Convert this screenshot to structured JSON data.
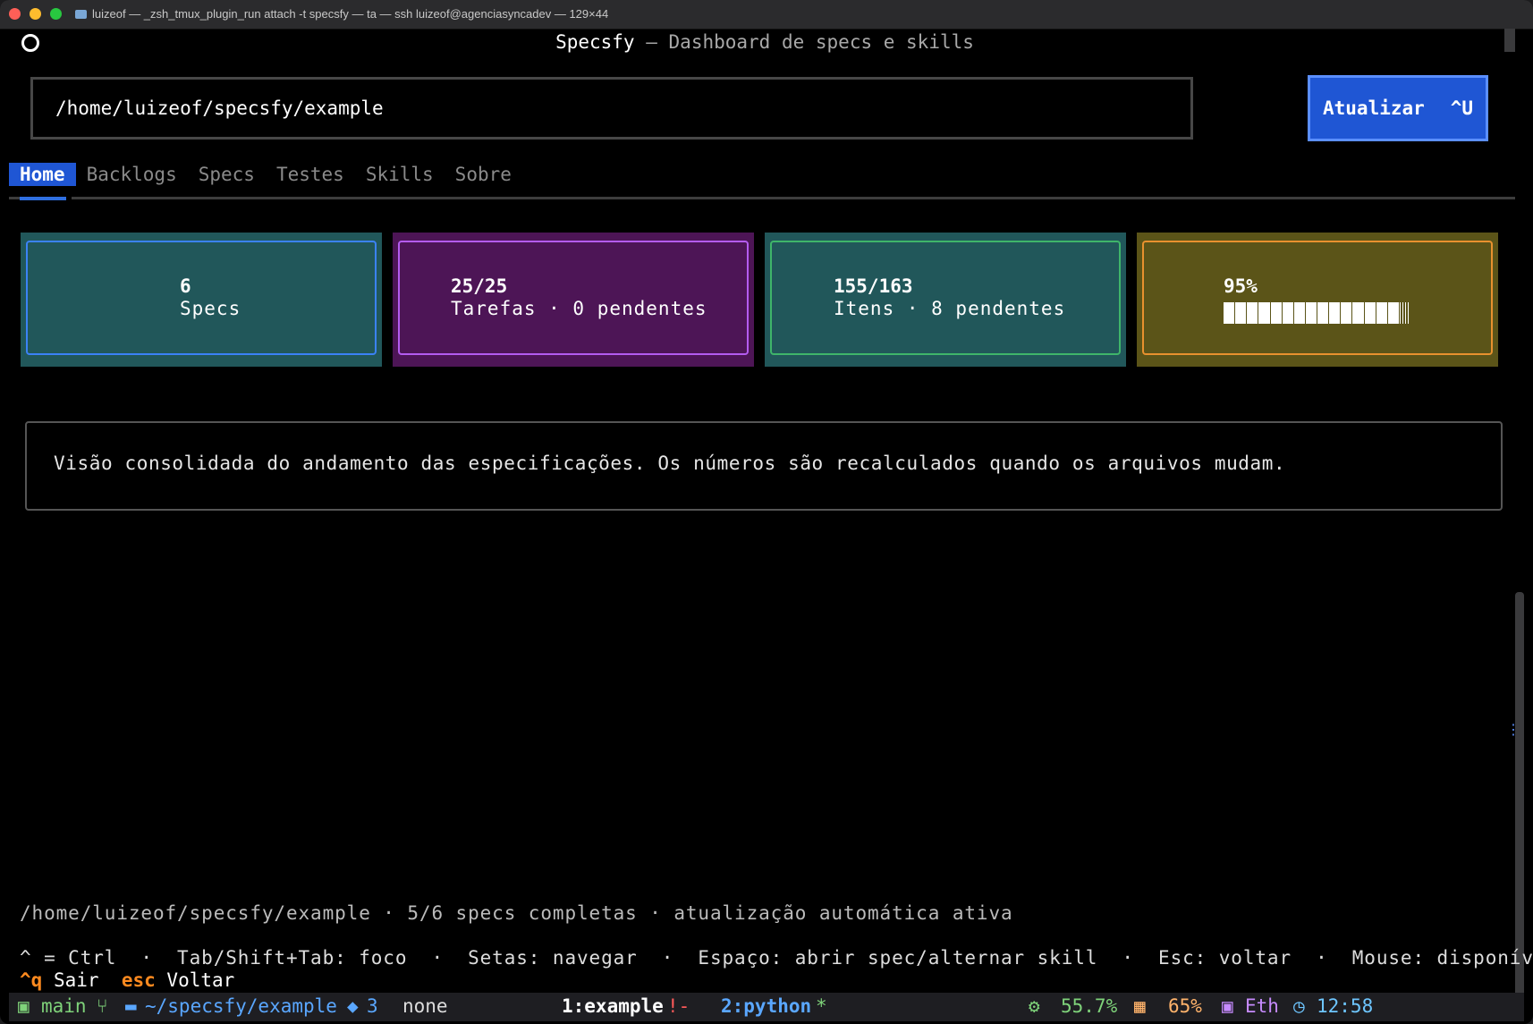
{
  "window": {
    "title": "luizeof — _zsh_tmux_plugin_run attach -t specsfy — ta — ssh luizeof@agenciasyncadev — 129×44"
  },
  "header": {
    "app_name": "Specsfy",
    "separator": " — ",
    "subtitle": "Dashboard de specs e skills"
  },
  "path_input": {
    "value": "/home/luizeof/specsfy/example"
  },
  "refresh_button": {
    "label": "Atualizar",
    "shortcut": "^U"
  },
  "tabs": [
    {
      "label": "Home",
      "active": true
    },
    {
      "label": "Backlogs",
      "active": false
    },
    {
      "label": "Specs",
      "active": false
    },
    {
      "label": "Testes",
      "active": false
    },
    {
      "label": "Skills",
      "active": false
    },
    {
      "label": "Sobre",
      "active": false
    }
  ],
  "cards": [
    {
      "value": "6",
      "label": "Specs",
      "color": "#21575a",
      "border": "#3b82f6"
    },
    {
      "value": "25/25",
      "label": "Tarefas · 0 pendentes",
      "color": "#4d1556",
      "border": "#b45cf0"
    },
    {
      "value": "155/163",
      "label": "Itens · 8 pendentes",
      "color": "#21575a",
      "border": "#3fb56a"
    },
    {
      "value": "95%",
      "progress": 0.95,
      "color": "#5b5418",
      "border": "#e8912e"
    }
  ],
  "description": "Visão consolidada do andamento das especificações. Os números são recalculados quando os arquivos mudam.",
  "status_line": "/home/luizeof/specsfy/example · 5/6 specs completas · atualização automática ativa",
  "hints_line": "^ = Ctrl  ·  Tab/Shift+Tab: foco  ·  Setas: navegar  ·  Espaço: abrir spec/alternar skill  ·  Esc: voltar  ·  Mouse: disponível",
  "keys": {
    "quit_key": "^q",
    "quit_label": "Sair",
    "back_key": "esc",
    "back_label": "Voltar"
  },
  "tmux": {
    "branch": "main",
    "path": "~/specsfy/example",
    "docker_count": "3",
    "kube_context": "none",
    "window1": "1:example",
    "window1_flag": "!-",
    "window2": "2:python",
    "window2_flag": "*",
    "cpu": "55.7%",
    "mem": "65%",
    "net": "Eth",
    "time": "12:58"
  },
  "colors": {
    "accent": "#1f56d4",
    "quit_key": "#ff8a1f"
  }
}
